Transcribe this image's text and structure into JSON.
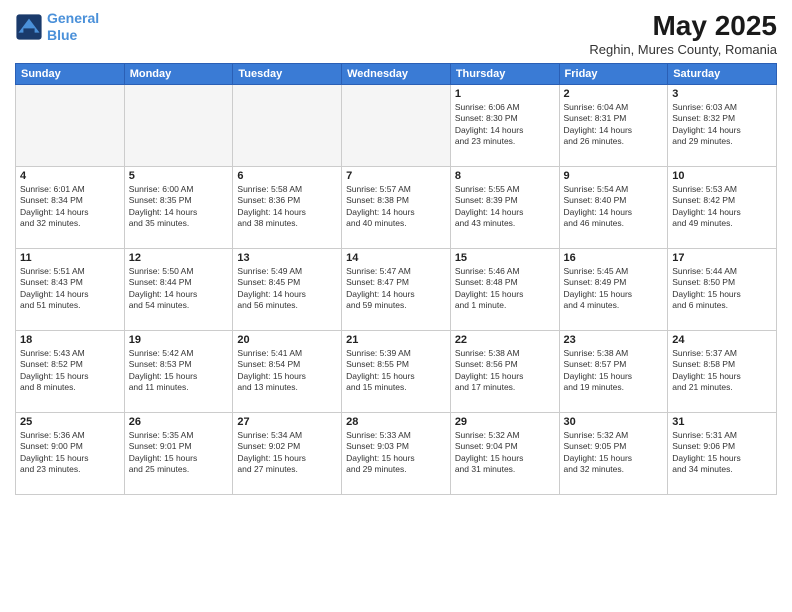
{
  "header": {
    "logo_line1": "General",
    "logo_line2": "Blue",
    "main_title": "May 2025",
    "sub_title": "Reghin, Mures County, Romania"
  },
  "weekdays": [
    "Sunday",
    "Monday",
    "Tuesday",
    "Wednesday",
    "Thursday",
    "Friday",
    "Saturday"
  ],
  "weeks": [
    [
      {
        "day": "",
        "info": ""
      },
      {
        "day": "",
        "info": ""
      },
      {
        "day": "",
        "info": ""
      },
      {
        "day": "",
        "info": ""
      },
      {
        "day": "1",
        "info": "Sunrise: 6:06 AM\nSunset: 8:30 PM\nDaylight: 14 hours\nand 23 minutes."
      },
      {
        "day": "2",
        "info": "Sunrise: 6:04 AM\nSunset: 8:31 PM\nDaylight: 14 hours\nand 26 minutes."
      },
      {
        "day": "3",
        "info": "Sunrise: 6:03 AM\nSunset: 8:32 PM\nDaylight: 14 hours\nand 29 minutes."
      }
    ],
    [
      {
        "day": "4",
        "info": "Sunrise: 6:01 AM\nSunset: 8:34 PM\nDaylight: 14 hours\nand 32 minutes."
      },
      {
        "day": "5",
        "info": "Sunrise: 6:00 AM\nSunset: 8:35 PM\nDaylight: 14 hours\nand 35 minutes."
      },
      {
        "day": "6",
        "info": "Sunrise: 5:58 AM\nSunset: 8:36 PM\nDaylight: 14 hours\nand 38 minutes."
      },
      {
        "day": "7",
        "info": "Sunrise: 5:57 AM\nSunset: 8:38 PM\nDaylight: 14 hours\nand 40 minutes."
      },
      {
        "day": "8",
        "info": "Sunrise: 5:55 AM\nSunset: 8:39 PM\nDaylight: 14 hours\nand 43 minutes."
      },
      {
        "day": "9",
        "info": "Sunrise: 5:54 AM\nSunset: 8:40 PM\nDaylight: 14 hours\nand 46 minutes."
      },
      {
        "day": "10",
        "info": "Sunrise: 5:53 AM\nSunset: 8:42 PM\nDaylight: 14 hours\nand 49 minutes."
      }
    ],
    [
      {
        "day": "11",
        "info": "Sunrise: 5:51 AM\nSunset: 8:43 PM\nDaylight: 14 hours\nand 51 minutes."
      },
      {
        "day": "12",
        "info": "Sunrise: 5:50 AM\nSunset: 8:44 PM\nDaylight: 14 hours\nand 54 minutes."
      },
      {
        "day": "13",
        "info": "Sunrise: 5:49 AM\nSunset: 8:45 PM\nDaylight: 14 hours\nand 56 minutes."
      },
      {
        "day": "14",
        "info": "Sunrise: 5:47 AM\nSunset: 8:47 PM\nDaylight: 14 hours\nand 59 minutes."
      },
      {
        "day": "15",
        "info": "Sunrise: 5:46 AM\nSunset: 8:48 PM\nDaylight: 15 hours\nand 1 minute."
      },
      {
        "day": "16",
        "info": "Sunrise: 5:45 AM\nSunset: 8:49 PM\nDaylight: 15 hours\nand 4 minutes."
      },
      {
        "day": "17",
        "info": "Sunrise: 5:44 AM\nSunset: 8:50 PM\nDaylight: 15 hours\nand 6 minutes."
      }
    ],
    [
      {
        "day": "18",
        "info": "Sunrise: 5:43 AM\nSunset: 8:52 PM\nDaylight: 15 hours\nand 8 minutes."
      },
      {
        "day": "19",
        "info": "Sunrise: 5:42 AM\nSunset: 8:53 PM\nDaylight: 15 hours\nand 11 minutes."
      },
      {
        "day": "20",
        "info": "Sunrise: 5:41 AM\nSunset: 8:54 PM\nDaylight: 15 hours\nand 13 minutes."
      },
      {
        "day": "21",
        "info": "Sunrise: 5:39 AM\nSunset: 8:55 PM\nDaylight: 15 hours\nand 15 minutes."
      },
      {
        "day": "22",
        "info": "Sunrise: 5:38 AM\nSunset: 8:56 PM\nDaylight: 15 hours\nand 17 minutes."
      },
      {
        "day": "23",
        "info": "Sunrise: 5:38 AM\nSunset: 8:57 PM\nDaylight: 15 hours\nand 19 minutes."
      },
      {
        "day": "24",
        "info": "Sunrise: 5:37 AM\nSunset: 8:58 PM\nDaylight: 15 hours\nand 21 minutes."
      }
    ],
    [
      {
        "day": "25",
        "info": "Sunrise: 5:36 AM\nSunset: 9:00 PM\nDaylight: 15 hours\nand 23 minutes."
      },
      {
        "day": "26",
        "info": "Sunrise: 5:35 AM\nSunset: 9:01 PM\nDaylight: 15 hours\nand 25 minutes."
      },
      {
        "day": "27",
        "info": "Sunrise: 5:34 AM\nSunset: 9:02 PM\nDaylight: 15 hours\nand 27 minutes."
      },
      {
        "day": "28",
        "info": "Sunrise: 5:33 AM\nSunset: 9:03 PM\nDaylight: 15 hours\nand 29 minutes."
      },
      {
        "day": "29",
        "info": "Sunrise: 5:32 AM\nSunset: 9:04 PM\nDaylight: 15 hours\nand 31 minutes."
      },
      {
        "day": "30",
        "info": "Sunrise: 5:32 AM\nSunset: 9:05 PM\nDaylight: 15 hours\nand 32 minutes."
      },
      {
        "day": "31",
        "info": "Sunrise: 5:31 AM\nSunset: 9:06 PM\nDaylight: 15 hours\nand 34 minutes."
      }
    ]
  ]
}
